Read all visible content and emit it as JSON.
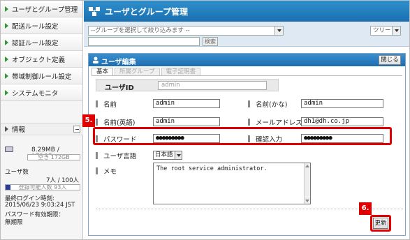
{
  "sidebar": {
    "items": [
      {
        "label": "ユーザとグループ管理"
      },
      {
        "label": "配送ルール設定"
      },
      {
        "label": "認証ルール設定"
      },
      {
        "label": "オブジェクト定義"
      },
      {
        "label": "帯域制御ルール設定"
      },
      {
        "label": "システムモニタ"
      }
    ],
    "info": {
      "header": "情報",
      "disk_usage": "8.29MB / 172GB",
      "disk_free": "空き 172GB",
      "disk_used_fraction": 0.0,
      "user_count_label": "ユーザ数",
      "user_count": "7人 / 100人",
      "user_registrable": "登録可能人数 93人",
      "user_used_fraction": 0.07,
      "last_login_label": "最終ログイン時刻:",
      "last_login": "2015/06/23 9:03:24 JST",
      "password_expiry_label": "パスワード有効期限：",
      "password_expiry": "無期限"
    }
  },
  "header": {
    "title": "ユーザとグループ管理",
    "group_placeholder": "--グループを選択して絞り込みます --",
    "search_label": "検索",
    "tree_label": "ツリー"
  },
  "panel": {
    "title": "ユーザ編集",
    "close_label": "閉じる",
    "tabs": [
      {
        "label": "基本"
      },
      {
        "label": "所属グループ"
      },
      {
        "label": "電子証明書"
      }
    ],
    "userid_label": "ユーザID",
    "userid_value": "admin",
    "name_label": "名前",
    "name_value": "admin",
    "name_kana_label": "名前(かな)",
    "name_kana_value": "admin",
    "name_en_label": "名前(英語)",
    "name_en_value": "admin",
    "email_label": "メールアドレス",
    "email_value": "dh1@dh.co.jp",
    "password_label": "パスワード",
    "password_value": "●●●●●●●●●",
    "confirm_label": "確認入力",
    "confirm_value": "●●●●●●●●●",
    "language_label": "ユーザ言語",
    "language_value": "日本語",
    "memo_label": "メモ",
    "memo_value": "The root service administrator.",
    "update_label": "更新"
  },
  "annotations": {
    "step5": "5.",
    "step6": "6.",
    "highlight_color": "#e00000"
  }
}
